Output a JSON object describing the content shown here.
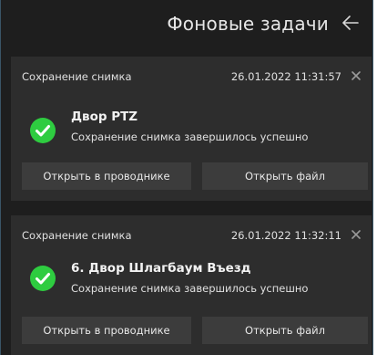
{
  "header": {
    "title": "Фоновые задачи",
    "back_icon": "arrow-left-icon"
  },
  "tasks": [
    {
      "title": "Сохранение снимка",
      "timestamp": "26.01.2022 11:31:57",
      "name": "Двор PTZ",
      "status": "Сохранение снимка завершилось успешно",
      "open_explorer_label": "Открыть в проводнике",
      "open_file_label": "Открыть файл",
      "status_icon": "check-circle-icon"
    },
    {
      "title": "Сохранение снимка",
      "timestamp": "26.01.2022 11:32:11",
      "name": "6. Двор Шлагбаум Въезд",
      "status": "Сохранение снимка завершилось успешно",
      "open_explorer_label": "Открыть в проводнике",
      "open_file_label": "Открыть файл",
      "status_icon": "check-circle-icon"
    }
  ],
  "colors": {
    "success": "#2ecc40",
    "panel_bg": "#1e1e1e",
    "card_bg": "#2d2d2d",
    "button_bg": "#3c3c3c"
  }
}
